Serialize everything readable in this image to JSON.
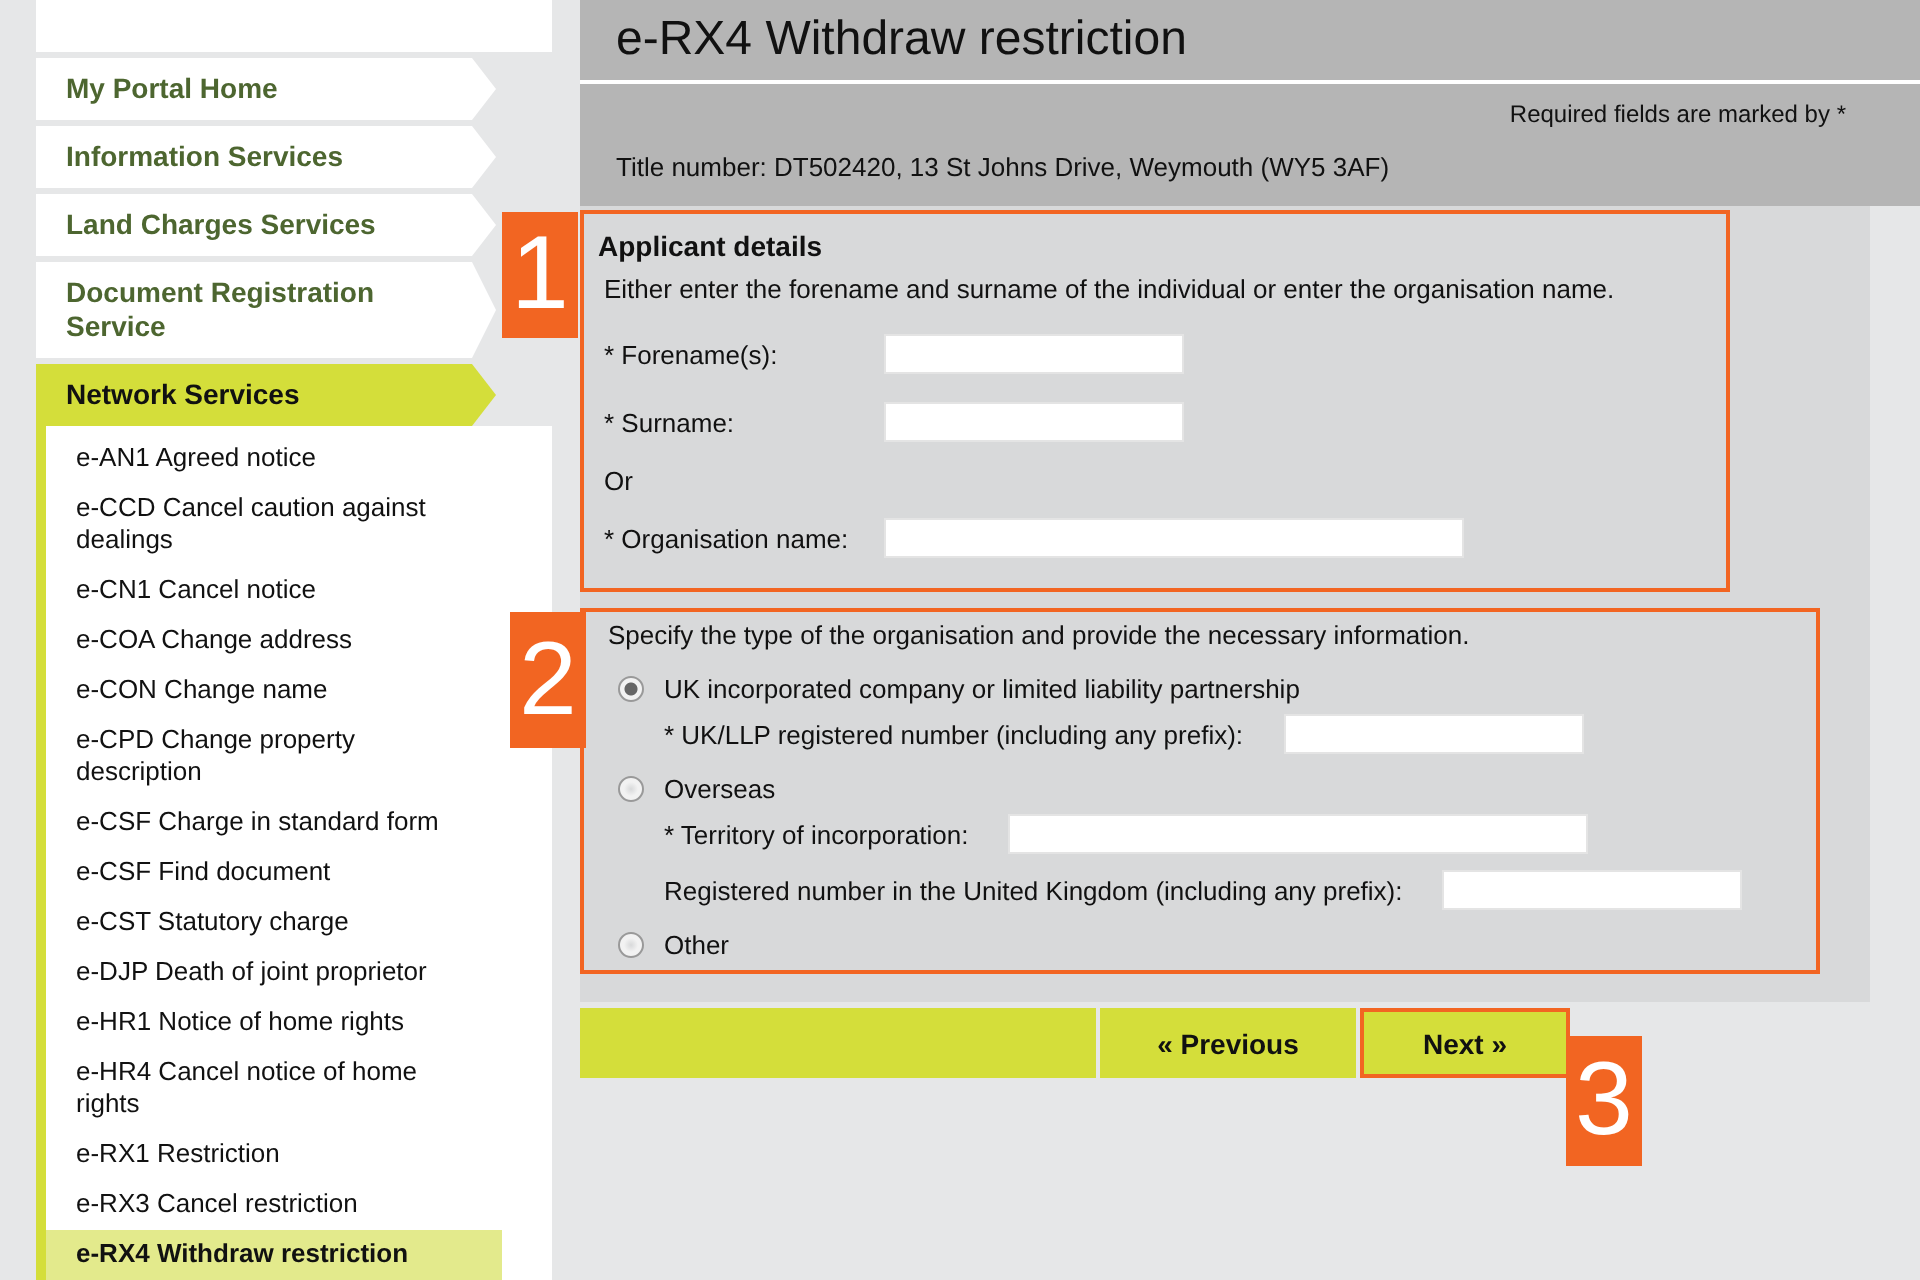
{
  "sidebar": {
    "nav": [
      {
        "label": "My Portal Home",
        "selected": false
      },
      {
        "label": "Information Services",
        "selected": false
      },
      {
        "label": "Land Charges Services",
        "selected": false
      },
      {
        "label": "Document Registration Service",
        "selected": false
      },
      {
        "label": "Network Services",
        "selected": true
      }
    ],
    "subitems": [
      {
        "label": "e-AN1 Agreed notice",
        "selected": false
      },
      {
        "label": "e-CCD Cancel caution against dealings",
        "selected": false
      },
      {
        "label": "e-CN1 Cancel notice",
        "selected": false
      },
      {
        "label": "e-COA Change address",
        "selected": false
      },
      {
        "label": "e-CON Change name",
        "selected": false
      },
      {
        "label": "e-CPD Change property description",
        "selected": false
      },
      {
        "label": "e-CSF Charge in standard form",
        "selected": false
      },
      {
        "label": "e-CSF Find document",
        "selected": false
      },
      {
        "label": "e-CST Statutory charge",
        "selected": false
      },
      {
        "label": "e-DJP Death of joint proprietor",
        "selected": false
      },
      {
        "label": "e-HR1 Notice of home rights",
        "selected": false
      },
      {
        "label": "e-HR4 Cancel notice of home rights",
        "selected": false
      },
      {
        "label": "e-RX1 Restriction",
        "selected": false
      },
      {
        "label": "e-RX3 Cancel restriction",
        "selected": false
      },
      {
        "label": "e-RX4 Withdraw restriction",
        "selected": true
      }
    ]
  },
  "page": {
    "title": "e-RX4 Withdraw restriction",
    "required_note": "Required fields are marked by *",
    "title_number": "Title number: DT502420, 13 St Johns Drive, Weymouth (WY5 3AF)"
  },
  "applicant": {
    "heading": "Applicant details",
    "intro": "Either enter the forename and surname of the individual or enter the organisation name.",
    "rows": [
      {
        "kind": "field",
        "label": "* Forename(s):",
        "wide": false
      },
      {
        "kind": "field",
        "label": "* Surname:",
        "wide": false
      },
      {
        "kind": "text",
        "label": "Or"
      },
      {
        "kind": "field",
        "label": "* Organisation name:",
        "wide": true
      }
    ]
  },
  "organisation": {
    "instruction": "Specify the type of the organisation and provide the necessary information.",
    "options": [
      {
        "label": "UK incorporated company or limited liability partnership",
        "selected": true,
        "fields": [
          "* UK/LLP registered number (including any prefix):"
        ]
      },
      {
        "label": "Overseas",
        "selected": false,
        "fields": [
          "* Territory of incorporation:",
          "Registered number in the United Kingdom (including any prefix):"
        ]
      },
      {
        "label": "Other",
        "selected": false
      }
    ]
  },
  "buttons": [
    {
      "label": "« Previous",
      "highlighted": false
    },
    {
      "label": "Next »",
      "highlighted": true
    }
  ],
  "callouts": [
    "1",
    "2",
    "3"
  ]
}
